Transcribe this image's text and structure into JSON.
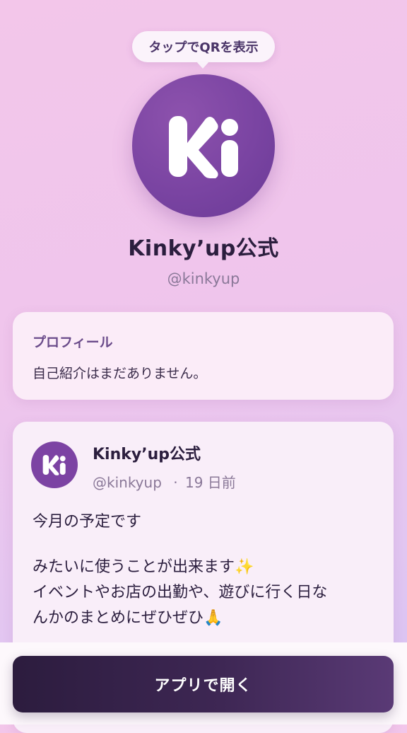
{
  "tooltip": {
    "label": "タップでQRを表示"
  },
  "profile": {
    "avatar_icon": "ki-logo-icon",
    "avatar_text": "Ki",
    "name": "Kinky’up公式",
    "handle": "@kinkyup"
  },
  "profile_card": {
    "heading": "プロフィール",
    "bio": "自己紹介はまだありません。"
  },
  "post": {
    "avatar_icon": "ki-logo-icon",
    "author_name": "Kinky’up公式",
    "author_handle": "@kinkyup",
    "separator": "·",
    "time_ago": "19 日前",
    "body_lines": [
      "今月の予定です",
      "みたいに使うことが出来ます✨",
      "イベントやお店の出勤や、遊びに行く日な",
      "んかのまとめにぜひぜひ🙏"
    ]
  },
  "bottom": {
    "open_app_label": "アプリで開く"
  },
  "colors": {
    "brand_purple": "#7c43a3",
    "button_dark": "#2c1c3e",
    "background_pink": "#f3c6ea"
  }
}
